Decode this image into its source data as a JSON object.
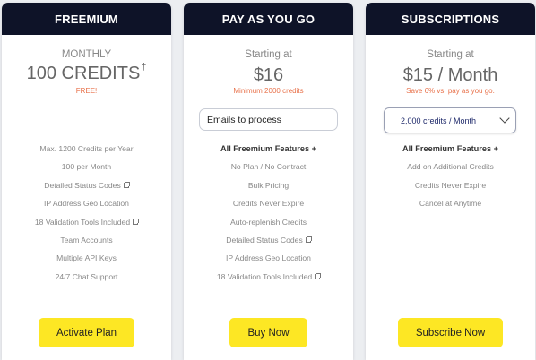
{
  "colors": {
    "header_bg": "#0e1328",
    "accent": "#e8714a",
    "button_bg": "#fde724"
  },
  "freemium": {
    "title": "FREEMIUM",
    "period": "MONTHLY",
    "credits": "100 CREDITS",
    "dagger": "†",
    "note": "FREE!",
    "features": [
      {
        "text": "Max. 1200 Credits per Year"
      },
      {
        "text": "100 per Month"
      },
      {
        "text": "Detailed Status Codes",
        "icon": "external-link-icon"
      },
      {
        "text": "IP Address Geo Location"
      },
      {
        "text": "18 Validation Tools Included",
        "icon": "external-link-icon"
      },
      {
        "text": "Team Accounts"
      },
      {
        "text": "Multiple API Keys"
      },
      {
        "text": "24/7 Chat Support"
      }
    ],
    "button": "Activate Plan"
  },
  "payg": {
    "title": "PAY AS YOU GO",
    "starting": "Starting at",
    "price": "$16",
    "note": "Minimum 2000 credits",
    "input_placeholder": "Emails to process",
    "features": [
      {
        "text": "All Freemium Features +",
        "bold": true
      },
      {
        "text": "No Plan / No Contract"
      },
      {
        "text": "Bulk Pricing"
      },
      {
        "text": "Credits Never Expire"
      },
      {
        "text": "Auto-replenish Credits"
      },
      {
        "text": "Detailed Status Codes",
        "icon": "external-link-icon"
      },
      {
        "text": "IP Address Geo Location"
      },
      {
        "text": "18 Validation Tools Included",
        "icon": "external-link-icon"
      }
    ],
    "button": "Buy Now"
  },
  "subscriptions": {
    "title": "SUBSCRIPTIONS",
    "starting": "Starting at",
    "price": "$15 / Month",
    "note": "Save 6% vs. pay as you go.",
    "select_value": "2,000 credits / Month",
    "features": [
      {
        "text": "All Freemium Features +",
        "bold": true
      },
      {
        "text": "Add on Additional Credits"
      },
      {
        "text": "Credits Never Expire"
      },
      {
        "text": "Cancel at Anytime"
      }
    ],
    "button": "Subscribe Now"
  }
}
